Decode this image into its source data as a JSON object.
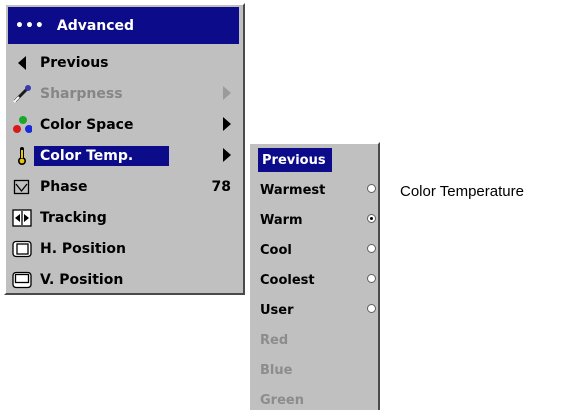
{
  "menu": {
    "title": "Advanced",
    "title_dots": "•••",
    "items": [
      {
        "label": "Previous",
        "icon": "previous-icon",
        "arrow": false,
        "value": "",
        "disabled": false,
        "selected": false
      },
      {
        "label": "Sharpness",
        "icon": "sharpness-icon",
        "arrow": true,
        "value": "",
        "disabled": true,
        "selected": false
      },
      {
        "label": "Color Space",
        "icon": "color-space-icon",
        "arrow": true,
        "value": "",
        "disabled": false,
        "selected": false
      },
      {
        "label": "Color Temp.",
        "icon": "color-temp-icon",
        "arrow": true,
        "value": "",
        "disabled": false,
        "selected": true
      },
      {
        "label": "Phase",
        "icon": "phase-icon",
        "arrow": false,
        "value": "78",
        "disabled": false,
        "selected": false
      },
      {
        "label": "Tracking",
        "icon": "tracking-icon",
        "arrow": false,
        "value": "",
        "disabled": false,
        "selected": false
      },
      {
        "label": "H. Position",
        "icon": "h-position-icon",
        "arrow": false,
        "value": "",
        "disabled": false,
        "selected": false
      },
      {
        "label": "V. Position",
        "icon": "v-position-icon",
        "arrow": false,
        "value": "",
        "disabled": false,
        "selected": false
      }
    ]
  },
  "submenu": {
    "items": [
      {
        "label": "Previous",
        "radio": false,
        "checked": false,
        "disabled": false,
        "selected": true
      },
      {
        "label": "Warmest",
        "radio": true,
        "checked": false,
        "disabled": false,
        "selected": false
      },
      {
        "label": "Warm",
        "radio": true,
        "checked": true,
        "disabled": false,
        "selected": false
      },
      {
        "label": "Cool",
        "radio": true,
        "checked": false,
        "disabled": false,
        "selected": false
      },
      {
        "label": "Coolest",
        "radio": true,
        "checked": false,
        "disabled": false,
        "selected": false
      },
      {
        "label": "User",
        "radio": true,
        "checked": false,
        "disabled": false,
        "selected": false
      },
      {
        "label": "Red",
        "radio": false,
        "checked": false,
        "disabled": true,
        "selected": false
      },
      {
        "label": "Blue",
        "radio": false,
        "checked": false,
        "disabled": true,
        "selected": false
      },
      {
        "label": "Green",
        "radio": false,
        "checked": false,
        "disabled": true,
        "selected": false
      }
    ]
  },
  "caption": "Color Temperature",
  "colors": {
    "menu_bg": "#c0c0c0",
    "highlight": "#0c0c8a",
    "disabled_text": "#868686"
  }
}
